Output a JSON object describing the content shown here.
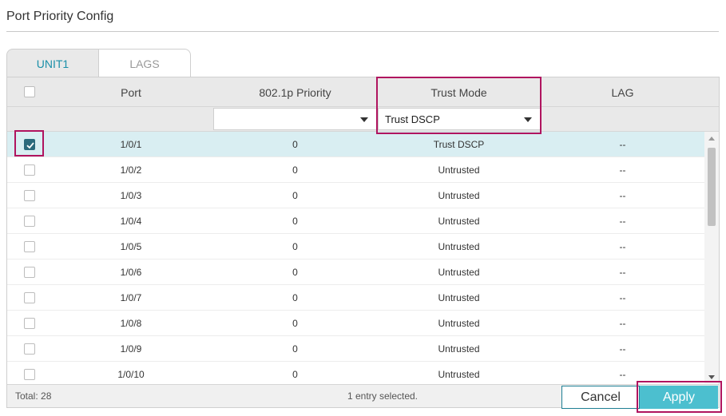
{
  "page": {
    "title": "Port Priority Config"
  },
  "tabs": [
    {
      "label": "UNIT1",
      "active": true
    },
    {
      "label": "LAGS",
      "active": false
    }
  ],
  "table": {
    "columns": {
      "port": "Port",
      "priority": "802.1p Priority",
      "trust_mode": "Trust Mode",
      "lag": "LAG"
    },
    "filters": {
      "priority": "",
      "trust_mode": "Trust DSCP"
    },
    "rows": [
      {
        "port": "1/0/1",
        "priority": "0",
        "trust_mode": "Trust DSCP",
        "lag": "--",
        "checked": true
      },
      {
        "port": "1/0/2",
        "priority": "0",
        "trust_mode": "Untrusted",
        "lag": "--",
        "checked": false
      },
      {
        "port": "1/0/3",
        "priority": "0",
        "trust_mode": "Untrusted",
        "lag": "--",
        "checked": false
      },
      {
        "port": "1/0/4",
        "priority": "0",
        "trust_mode": "Untrusted",
        "lag": "--",
        "checked": false
      },
      {
        "port": "1/0/5",
        "priority": "0",
        "trust_mode": "Untrusted",
        "lag": "--",
        "checked": false
      },
      {
        "port": "1/0/6",
        "priority": "0",
        "trust_mode": "Untrusted",
        "lag": "--",
        "checked": false
      },
      {
        "port": "1/0/7",
        "priority": "0",
        "trust_mode": "Untrusted",
        "lag": "--",
        "checked": false
      },
      {
        "port": "1/0/8",
        "priority": "0",
        "trust_mode": "Untrusted",
        "lag": "--",
        "checked": false
      },
      {
        "port": "1/0/9",
        "priority": "0",
        "trust_mode": "Untrusted",
        "lag": "--",
        "checked": false
      },
      {
        "port": "1/0/10",
        "priority": "0",
        "trust_mode": "Untrusted",
        "lag": "--",
        "checked": false
      }
    ]
  },
  "footer": {
    "total": "Total: 28",
    "selection": "1 entry selected."
  },
  "buttons": {
    "cancel": "Cancel",
    "apply": "Apply"
  },
  "colors": {
    "accent": "#4cbfcf",
    "highlight": "#b0145f",
    "selected_row": "#d9eef2",
    "tab_active_text": "#1a8fa8"
  }
}
